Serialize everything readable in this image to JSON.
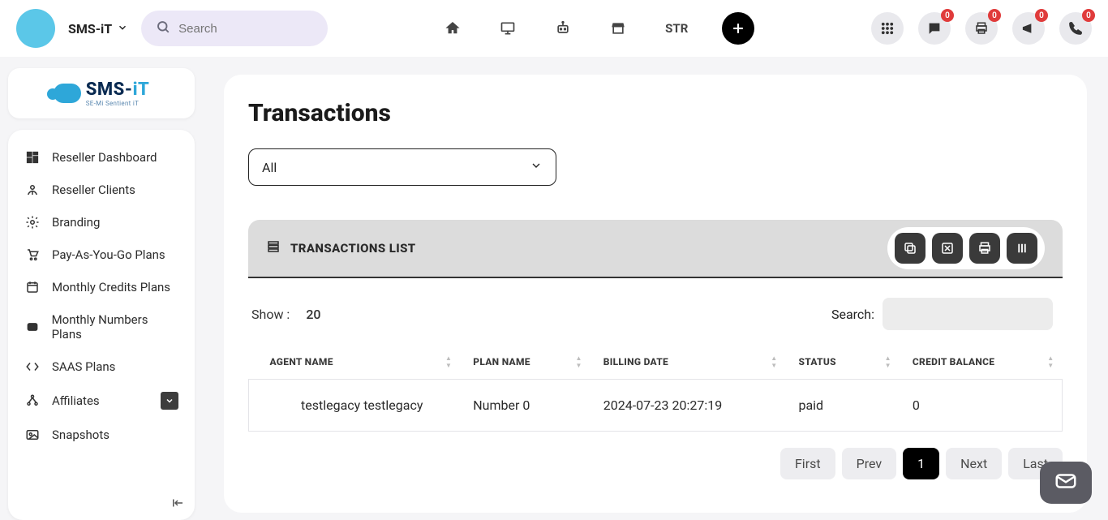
{
  "header": {
    "app_name": "SMS-iT",
    "search_placeholder": "Search",
    "nav_text_item": "STR",
    "badge_counts": {
      "chat": "0",
      "print": "0",
      "announce": "0",
      "phone": "0"
    }
  },
  "logo": {
    "main": "SMS-",
    "main2": "iT",
    "sub": "SE-Mi Sentient iT"
  },
  "sidebar": {
    "items": [
      {
        "label": "Reseller Dashboard"
      },
      {
        "label": "Reseller Clients"
      },
      {
        "label": "Branding"
      },
      {
        "label": "Pay-As-You-Go Plans"
      },
      {
        "label": "Monthly Credits Plans"
      },
      {
        "label": "Monthly Numbers Plans"
      },
      {
        "label": "SAAS Plans"
      },
      {
        "label": "Affiliates"
      },
      {
        "label": "Snapshots"
      }
    ]
  },
  "page": {
    "title": "Transactions",
    "filter_value": "All",
    "panel_title": "TRANSACTIONS LIST",
    "show_label": "Show :",
    "show_value": "20",
    "search_label": "Search:",
    "columns": {
      "agent": "AGENT NAME",
      "plan": "PLAN NAME",
      "billing": "BILLING DATE",
      "status": "STATUS",
      "credit": "CREDIT BALANCE"
    },
    "rows": [
      {
        "agent": "testlegacy testlegacy",
        "plan": "Number 0",
        "billing": "2024-07-23 20:27:19",
        "status": "paid",
        "credit": "0"
      }
    ],
    "pager": {
      "first": "First",
      "prev": "Prev",
      "page": "1",
      "next": "Next",
      "last": "Last"
    }
  }
}
